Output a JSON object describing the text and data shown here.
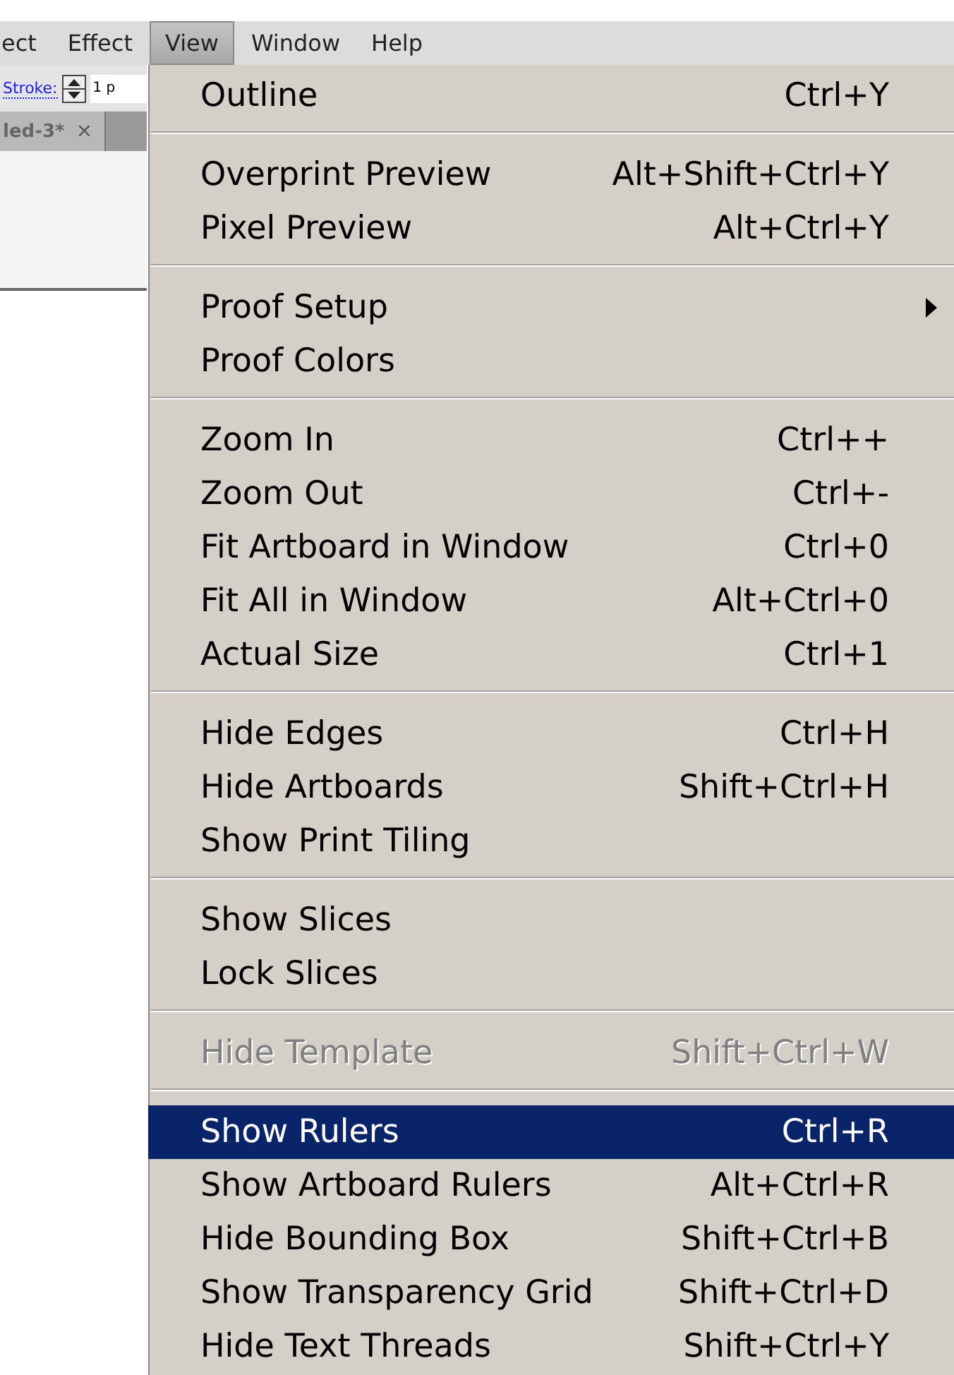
{
  "menu_bar": [
    {
      "label": "ect",
      "selected": false
    },
    {
      "label": "Effect",
      "selected": false
    },
    {
      "label": "View",
      "selected": true
    },
    {
      "label": "Window",
      "selected": false
    },
    {
      "label": "Help",
      "selected": false
    }
  ],
  "toolbar": {
    "stroke_label": "Stroke:",
    "stroke_value": "1 p"
  },
  "document_tab": {
    "title": "led-3*",
    "close": "×"
  },
  "view_menu": [
    [
      {
        "label": "Outline",
        "shortcut": "Ctrl+Y",
        "disabled": false,
        "selected": false,
        "submenu": false
      }
    ],
    [
      {
        "label": "Overprint Preview",
        "shortcut": "Alt+Shift+Ctrl+Y",
        "disabled": false,
        "selected": false,
        "submenu": false
      },
      {
        "label": "Pixel Preview",
        "shortcut": "Alt+Ctrl+Y",
        "disabled": false,
        "selected": false,
        "submenu": false
      }
    ],
    [
      {
        "label": "Proof Setup",
        "disabled": false,
        "selected": false,
        "submenu": true
      },
      {
        "label": "Proof Colors",
        "disabled": false,
        "selected": false,
        "submenu": false
      }
    ],
    [
      {
        "label": "Zoom In",
        "shortcut": "Ctrl++",
        "disabled": false,
        "selected": false,
        "submenu": false
      },
      {
        "label": "Zoom Out",
        "shortcut": "Ctrl+-",
        "disabled": false,
        "selected": false,
        "submenu": false
      },
      {
        "label": "Fit Artboard in Window",
        "shortcut": "Ctrl+0",
        "disabled": false,
        "selected": false,
        "submenu": false
      },
      {
        "label": "Fit All in Window",
        "shortcut": "Alt+Ctrl+0",
        "disabled": false,
        "selected": false,
        "submenu": false
      },
      {
        "label": "Actual Size",
        "shortcut": "Ctrl+1",
        "disabled": false,
        "selected": false,
        "submenu": false
      }
    ],
    [
      {
        "label": "Hide Edges",
        "shortcut": "Ctrl+H",
        "disabled": false,
        "selected": false,
        "submenu": false
      },
      {
        "label": "Hide Artboards",
        "shortcut": "Shift+Ctrl+H",
        "disabled": false,
        "selected": false,
        "submenu": false
      },
      {
        "label": "Show Print Tiling",
        "disabled": false,
        "selected": false,
        "submenu": false
      }
    ],
    [
      {
        "label": "Show Slices",
        "disabled": false,
        "selected": false,
        "submenu": false
      },
      {
        "label": "Lock Slices",
        "disabled": false,
        "selected": false,
        "submenu": false
      }
    ],
    [
      {
        "label": "Hide Template",
        "shortcut": "Shift+Ctrl+W",
        "disabled": true,
        "selected": false,
        "submenu": false
      }
    ],
    [
      {
        "label": "Show Rulers",
        "shortcut": "Ctrl+R",
        "disabled": false,
        "selected": true,
        "submenu": false
      },
      {
        "label": "Show Artboard Rulers",
        "shortcut": "Alt+Ctrl+R",
        "disabled": false,
        "selected": false,
        "submenu": false
      },
      {
        "label": "Hide Bounding Box",
        "shortcut": "Shift+Ctrl+B",
        "disabled": false,
        "selected": false,
        "submenu": false
      },
      {
        "label": "Show Transparency Grid",
        "shortcut": "Shift+Ctrl+D",
        "disabled": false,
        "selected": false,
        "submenu": false
      },
      {
        "label": "Hide Text Threads",
        "shortcut": "Shift+Ctrl+Y",
        "disabled": false,
        "selected": false,
        "submenu": false
      }
    ]
  ]
}
